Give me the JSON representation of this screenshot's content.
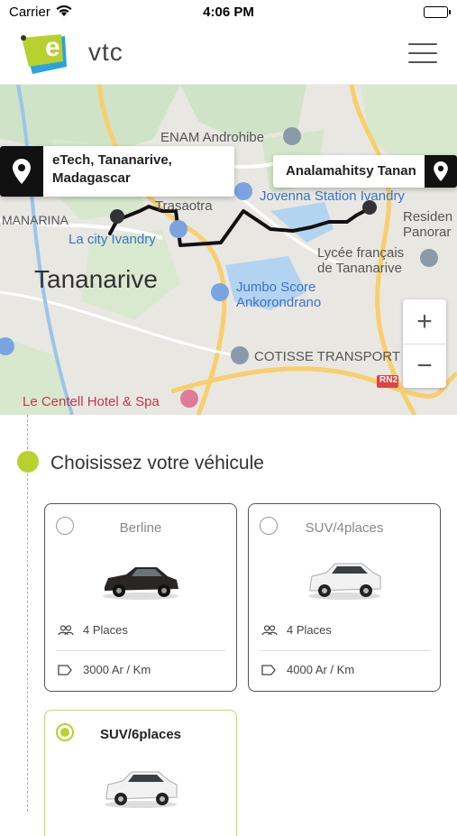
{
  "status_bar": {
    "carrier": "Carrier",
    "time": "4:06 PM"
  },
  "header": {
    "logo_letter": "e",
    "logo_text": "vtc"
  },
  "map": {
    "labels": {
      "enam": "ENAM Androhibe",
      "trasaotra": "Trasaotra",
      "jovenna": "Jovenna Station Ivandry",
      "manarina": "MANARINA",
      "lacity": "La city Ivandry",
      "tananarive": "Tananarive",
      "residence": "Residen",
      "panoramique": "Panorar",
      "lycee_line1": "Lycée français",
      "lycee_line2": "de Tananarive",
      "jumbo_line1": "Jumbo Score",
      "jumbo_line2": "Ankorondrano",
      "cotisse": "COTISSE TRANSPORT",
      "centell": "Le Centell Hotel & Spa",
      "rn2": "RN2"
    },
    "origin": {
      "line1": "eTech, Tananarive,",
      "line2": "Madagascar"
    },
    "destination": {
      "label": "Analamahitsy Tanan"
    },
    "zoom_in": "+",
    "zoom_out": "−"
  },
  "section": {
    "title": "Choisissez votre véhicule"
  },
  "vehicles": [
    {
      "name": "Berline",
      "places": "4 Places",
      "price": "3000 Ar / Km",
      "selected": false
    },
    {
      "name": "SUV/4places",
      "places": "4 Places",
      "price": "4000 Ar / Km",
      "selected": false
    },
    {
      "name": "SUV/6places",
      "selected": true
    }
  ],
  "colors": {
    "accent": "#b8d12f",
    "logo_blue": "#2aa3df",
    "route": "#111111"
  }
}
